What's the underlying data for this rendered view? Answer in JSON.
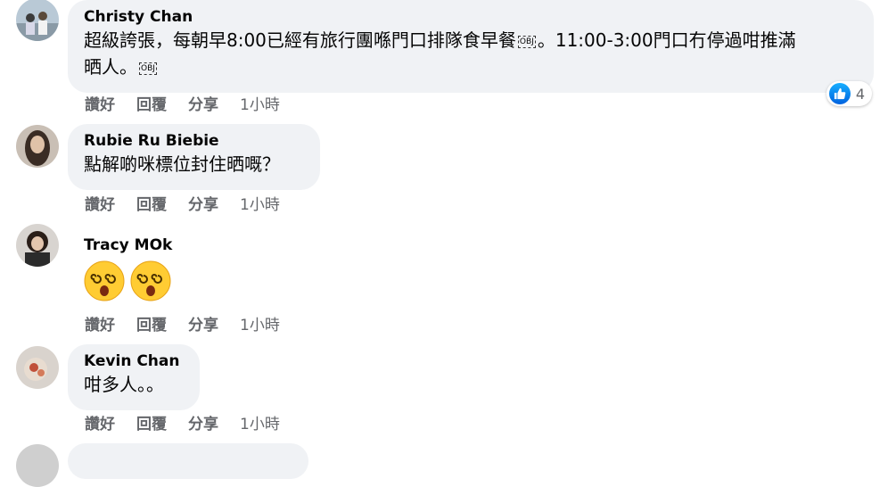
{
  "comments": [
    {
      "author": "Christy Chan",
      "text_part1": "超級誇張，每朝早8:00已經有旅行團喺門口排隊食早餐",
      "text_part2": "。11:00-3:00門口冇停過咁推滿",
      "text_part3": "晒人。",
      "obj_label": "OBJ",
      "like_label": "讚好",
      "reply_label": "回覆",
      "share_label": "分享",
      "time": "1小時",
      "reaction_count": "4"
    },
    {
      "author": "Rubie Ru Biebie",
      "text": "點解啲咪標位封住晒嘅？",
      "like_label": "讚好",
      "reply_label": "回覆",
      "share_label": "分享",
      "time": "1小時"
    },
    {
      "author": "Tracy MOk",
      "emoji_names": [
        "dizzy-face-emoji",
        "dizzy-face-emoji"
      ],
      "like_label": "讚好",
      "reply_label": "回覆",
      "share_label": "分享",
      "time": "1小時"
    },
    {
      "author": "Kevin Chan",
      "text": "咁多人。。",
      "like_label": "讚好",
      "reply_label": "回覆",
      "share_label": "分享",
      "time": "1小時"
    }
  ],
  "colors": {
    "bubble": "#f0f2f5",
    "action_text": "#65676b",
    "like_blue": "#1877f2"
  }
}
